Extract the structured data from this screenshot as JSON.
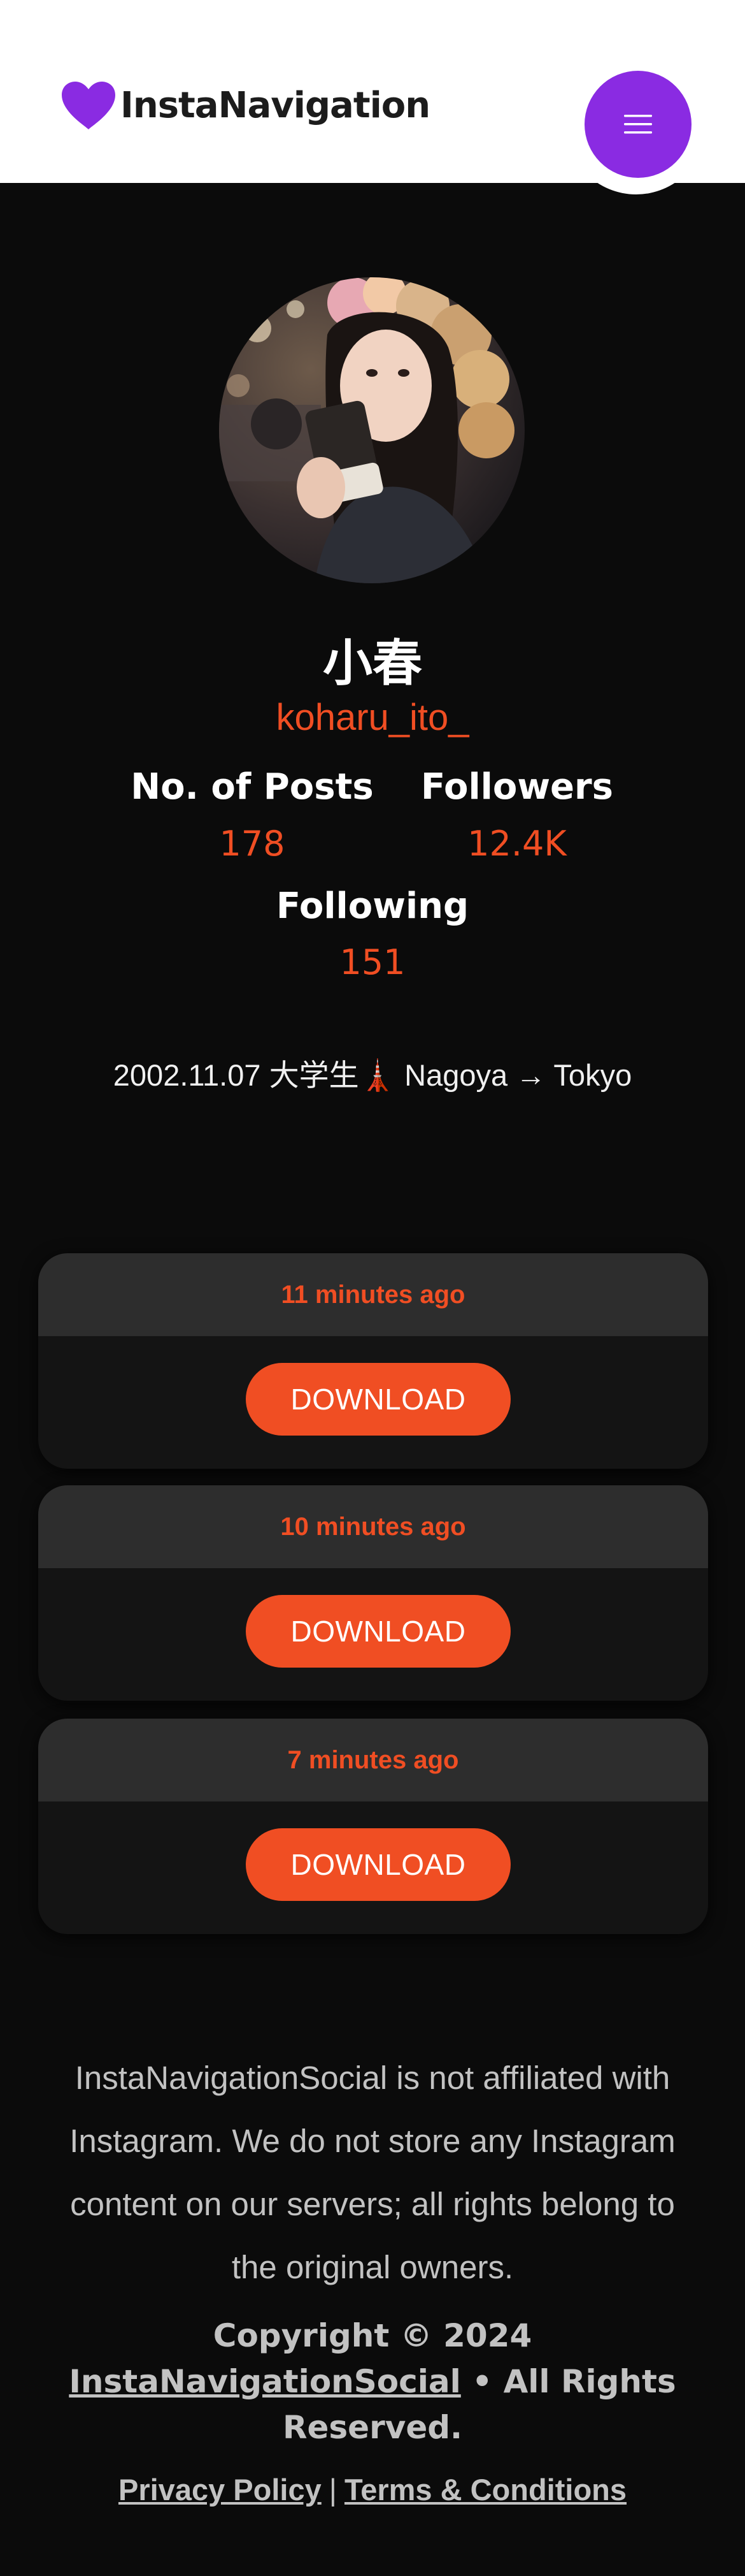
{
  "header": {
    "brand": "InstaNavigation",
    "brand_color": "#8a2be2",
    "logo_icon": "heart-icon",
    "menu_icon": "hamburger-menu-icon"
  },
  "profile": {
    "name": "小春",
    "username": "koharu_ito_",
    "stats": {
      "posts_label": "No. of Posts",
      "posts_value": "178",
      "followers_label": "Followers",
      "followers_value": "12.4K",
      "following_label": "Following",
      "following_value": "151"
    },
    "bio": "2002.11.07 大学生🗼 Nagoya → Tokyo"
  },
  "posts": [
    {
      "time": "11 minutes ago",
      "button": "DOWNLOAD"
    },
    {
      "time": "10 minutes ago",
      "button": "DOWNLOAD"
    },
    {
      "time": "7 minutes ago",
      "button": "DOWNLOAD"
    }
  ],
  "footer": {
    "disclaimer": "InstaNavigationSocial is not affiliated with Instagram. We do not store any Instagram content on our servers; all rights belong to the original owners.",
    "copyright_prefix": "Copyright © 2024",
    "copyright_site": "InstaNavigationSocial",
    "copyright_suffix": "• All Rights Reserved.",
    "privacy": "Privacy Policy",
    "separator": "|",
    "terms": "Terms & Conditions"
  },
  "colors": {
    "accent": "#f04e23",
    "background": "#0b0b0b",
    "card": "#141414",
    "card_header": "#2d2d2d"
  }
}
